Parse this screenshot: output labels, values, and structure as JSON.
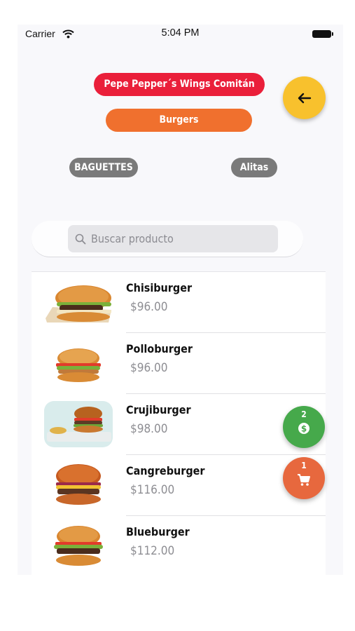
{
  "status_bar": {
    "carrier": "Carrier",
    "time": "5:04 PM"
  },
  "header": {
    "store_name": "Pepe Pepper´s Wings Comitán",
    "category": "Burgers",
    "back_icon": "arrow-left-icon",
    "accent_colors": {
      "store": "#ea1f3a",
      "category": "#f0702e",
      "back": "#f8c12d"
    }
  },
  "categories": [
    "BAGUETTES",
    "Alitas"
  ],
  "search": {
    "placeholder": "Buscar producto"
  },
  "products": [
    {
      "name": "Chisiburger",
      "price": "$96.00"
    },
    {
      "name": "Polloburger",
      "price": "$96.00"
    },
    {
      "name": "Crujiburger",
      "price": "$98.00"
    },
    {
      "name": "Cangreburger",
      "price": "$116.00"
    },
    {
      "name": "Blueburger",
      "price": "$112.00"
    }
  ],
  "fabs": {
    "orders": {
      "count": "2",
      "icon": "money-icon",
      "color": "#46a94b"
    },
    "cart": {
      "count": "1",
      "icon": "cart-icon",
      "color": "#e7683e"
    }
  }
}
